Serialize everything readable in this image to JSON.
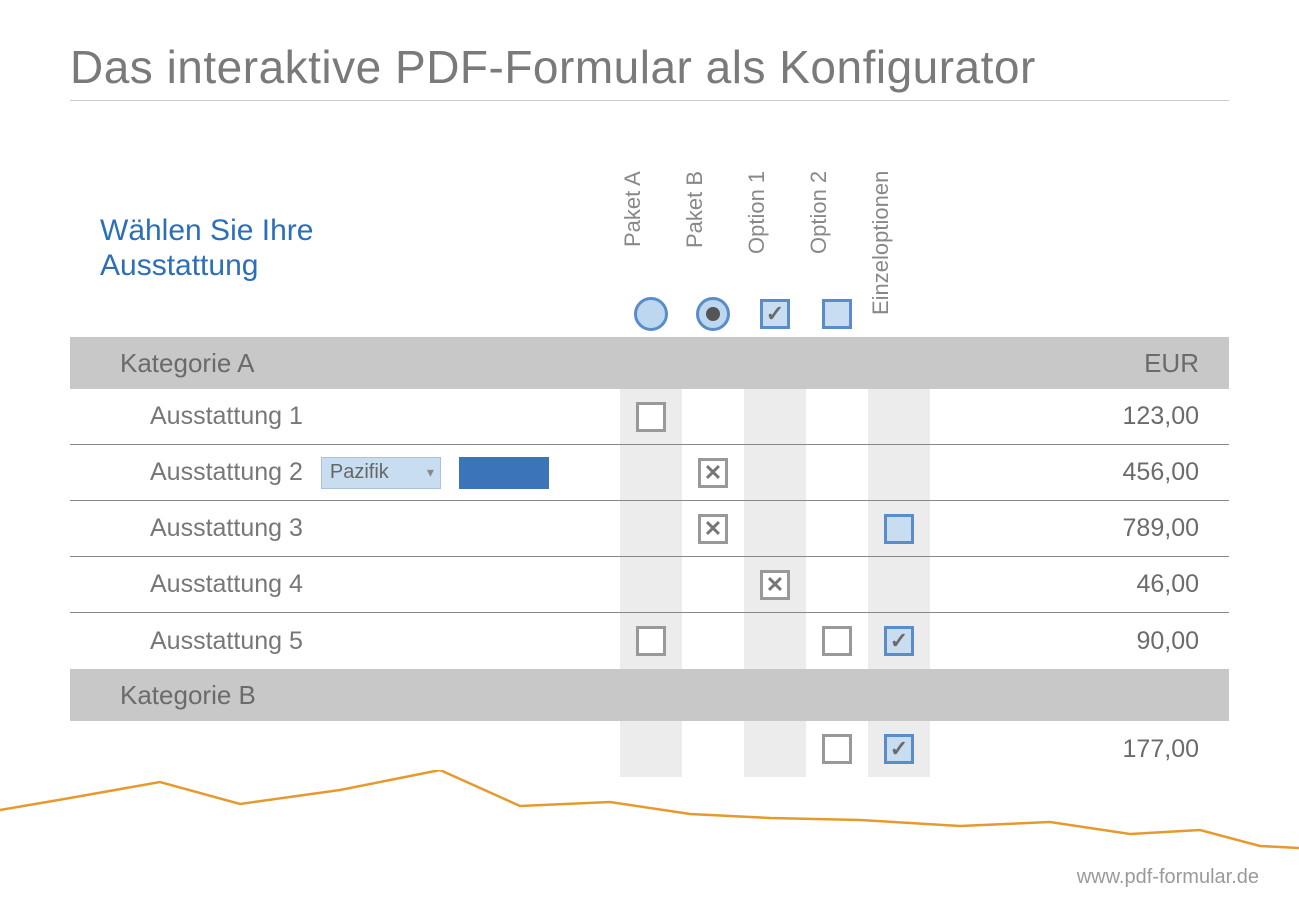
{
  "title": "Das interaktive PDF-Formular als Konfigurator",
  "subtitle_l1": "Wählen Sie Ihre",
  "subtitle_l2": "Ausstattung",
  "columns": {
    "paketA": "Paket A",
    "paketB": "Paket B",
    "option1": "Option 1",
    "option2": "Option 2",
    "einzel": "Einzeloptionen"
  },
  "header_controls": {
    "paketA": "radio-unchecked",
    "paketB": "radio-checked",
    "option1": "checkbox-tick",
    "option2": "checkbox-empty"
  },
  "categoryA": {
    "label": "Kategorie A",
    "currency": "EUR"
  },
  "rows": [
    {
      "label": "Ausstattung 1",
      "paketA": "empty",
      "paketB": "",
      "option1": "",
      "option2": "",
      "einzel": "",
      "price": "123,00"
    },
    {
      "label": "Ausstattung 2",
      "dropdown": "Pazifik",
      "swatch": "#3b74b9",
      "paketA": "",
      "paketB": "x",
      "option1": "",
      "option2": "",
      "einzel": "",
      "price": "456,00"
    },
    {
      "label": "Ausstattung 3",
      "paketA": "",
      "paketB": "x",
      "option1": "",
      "option2": "",
      "einzel": "blue-empty",
      "price": "789,00"
    },
    {
      "label": "Ausstattung 4",
      "paketA": "",
      "paketB": "",
      "option1": "x",
      "option2": "",
      "einzel": "",
      "price": "46,00"
    },
    {
      "label": "Ausstattung 5",
      "paketA": "empty",
      "paketB": "",
      "option1": "",
      "option2": "empty",
      "einzel": "blue-tick",
      "price": "90,00"
    }
  ],
  "categoryB": {
    "label": "Kategorie B"
  },
  "rowB": {
    "option2": "empty",
    "einzel": "blue-tick",
    "price": "177,00"
  },
  "footer": "www.pdf-formular.de"
}
